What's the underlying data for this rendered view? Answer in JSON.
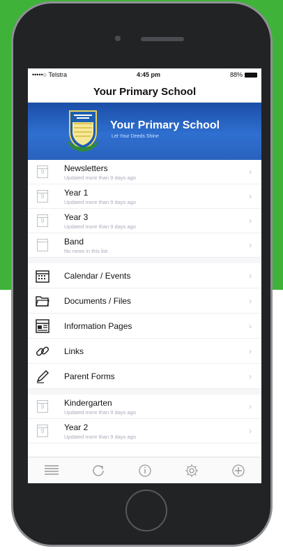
{
  "status_bar": {
    "carrier": "•••••○ Telstra",
    "time": "4:45 pm",
    "battery": "88%"
  },
  "header": {
    "title": "Your Primary School"
  },
  "banner": {
    "title": "Your Primary School",
    "motto": "Let Your Deeds Shine"
  },
  "news_lists": [
    {
      "title": "Newsletters",
      "subtitle": "Updated more than 9 days ago"
    },
    {
      "title": "Year 1",
      "subtitle": "Updated more than 9 days ago"
    },
    {
      "title": "Year 3",
      "subtitle": "Updated more than 9 days ago"
    },
    {
      "title": "Band",
      "subtitle": "No news in this list"
    }
  ],
  "menu_items": [
    {
      "title": "Calendar / Events",
      "icon": "calendar-icon"
    },
    {
      "title": "Documents / Files",
      "icon": "folder-icon"
    },
    {
      "title": "Information Pages",
      "icon": "info-pages-icon"
    },
    {
      "title": "Links",
      "icon": "link-icon"
    },
    {
      "title": "Parent Forms",
      "icon": "pen-icon"
    }
  ],
  "group_lists": [
    {
      "title": "Kindergarten",
      "subtitle": "Updated more than 9 days ago"
    },
    {
      "title": "Year 2",
      "subtitle": "Updated more than 9 days ago"
    }
  ],
  "calendar_day": "9",
  "tab_bar": [
    "menu-lines-icon",
    "refresh-icon",
    "info-icon",
    "settings-icon",
    "add-icon"
  ]
}
